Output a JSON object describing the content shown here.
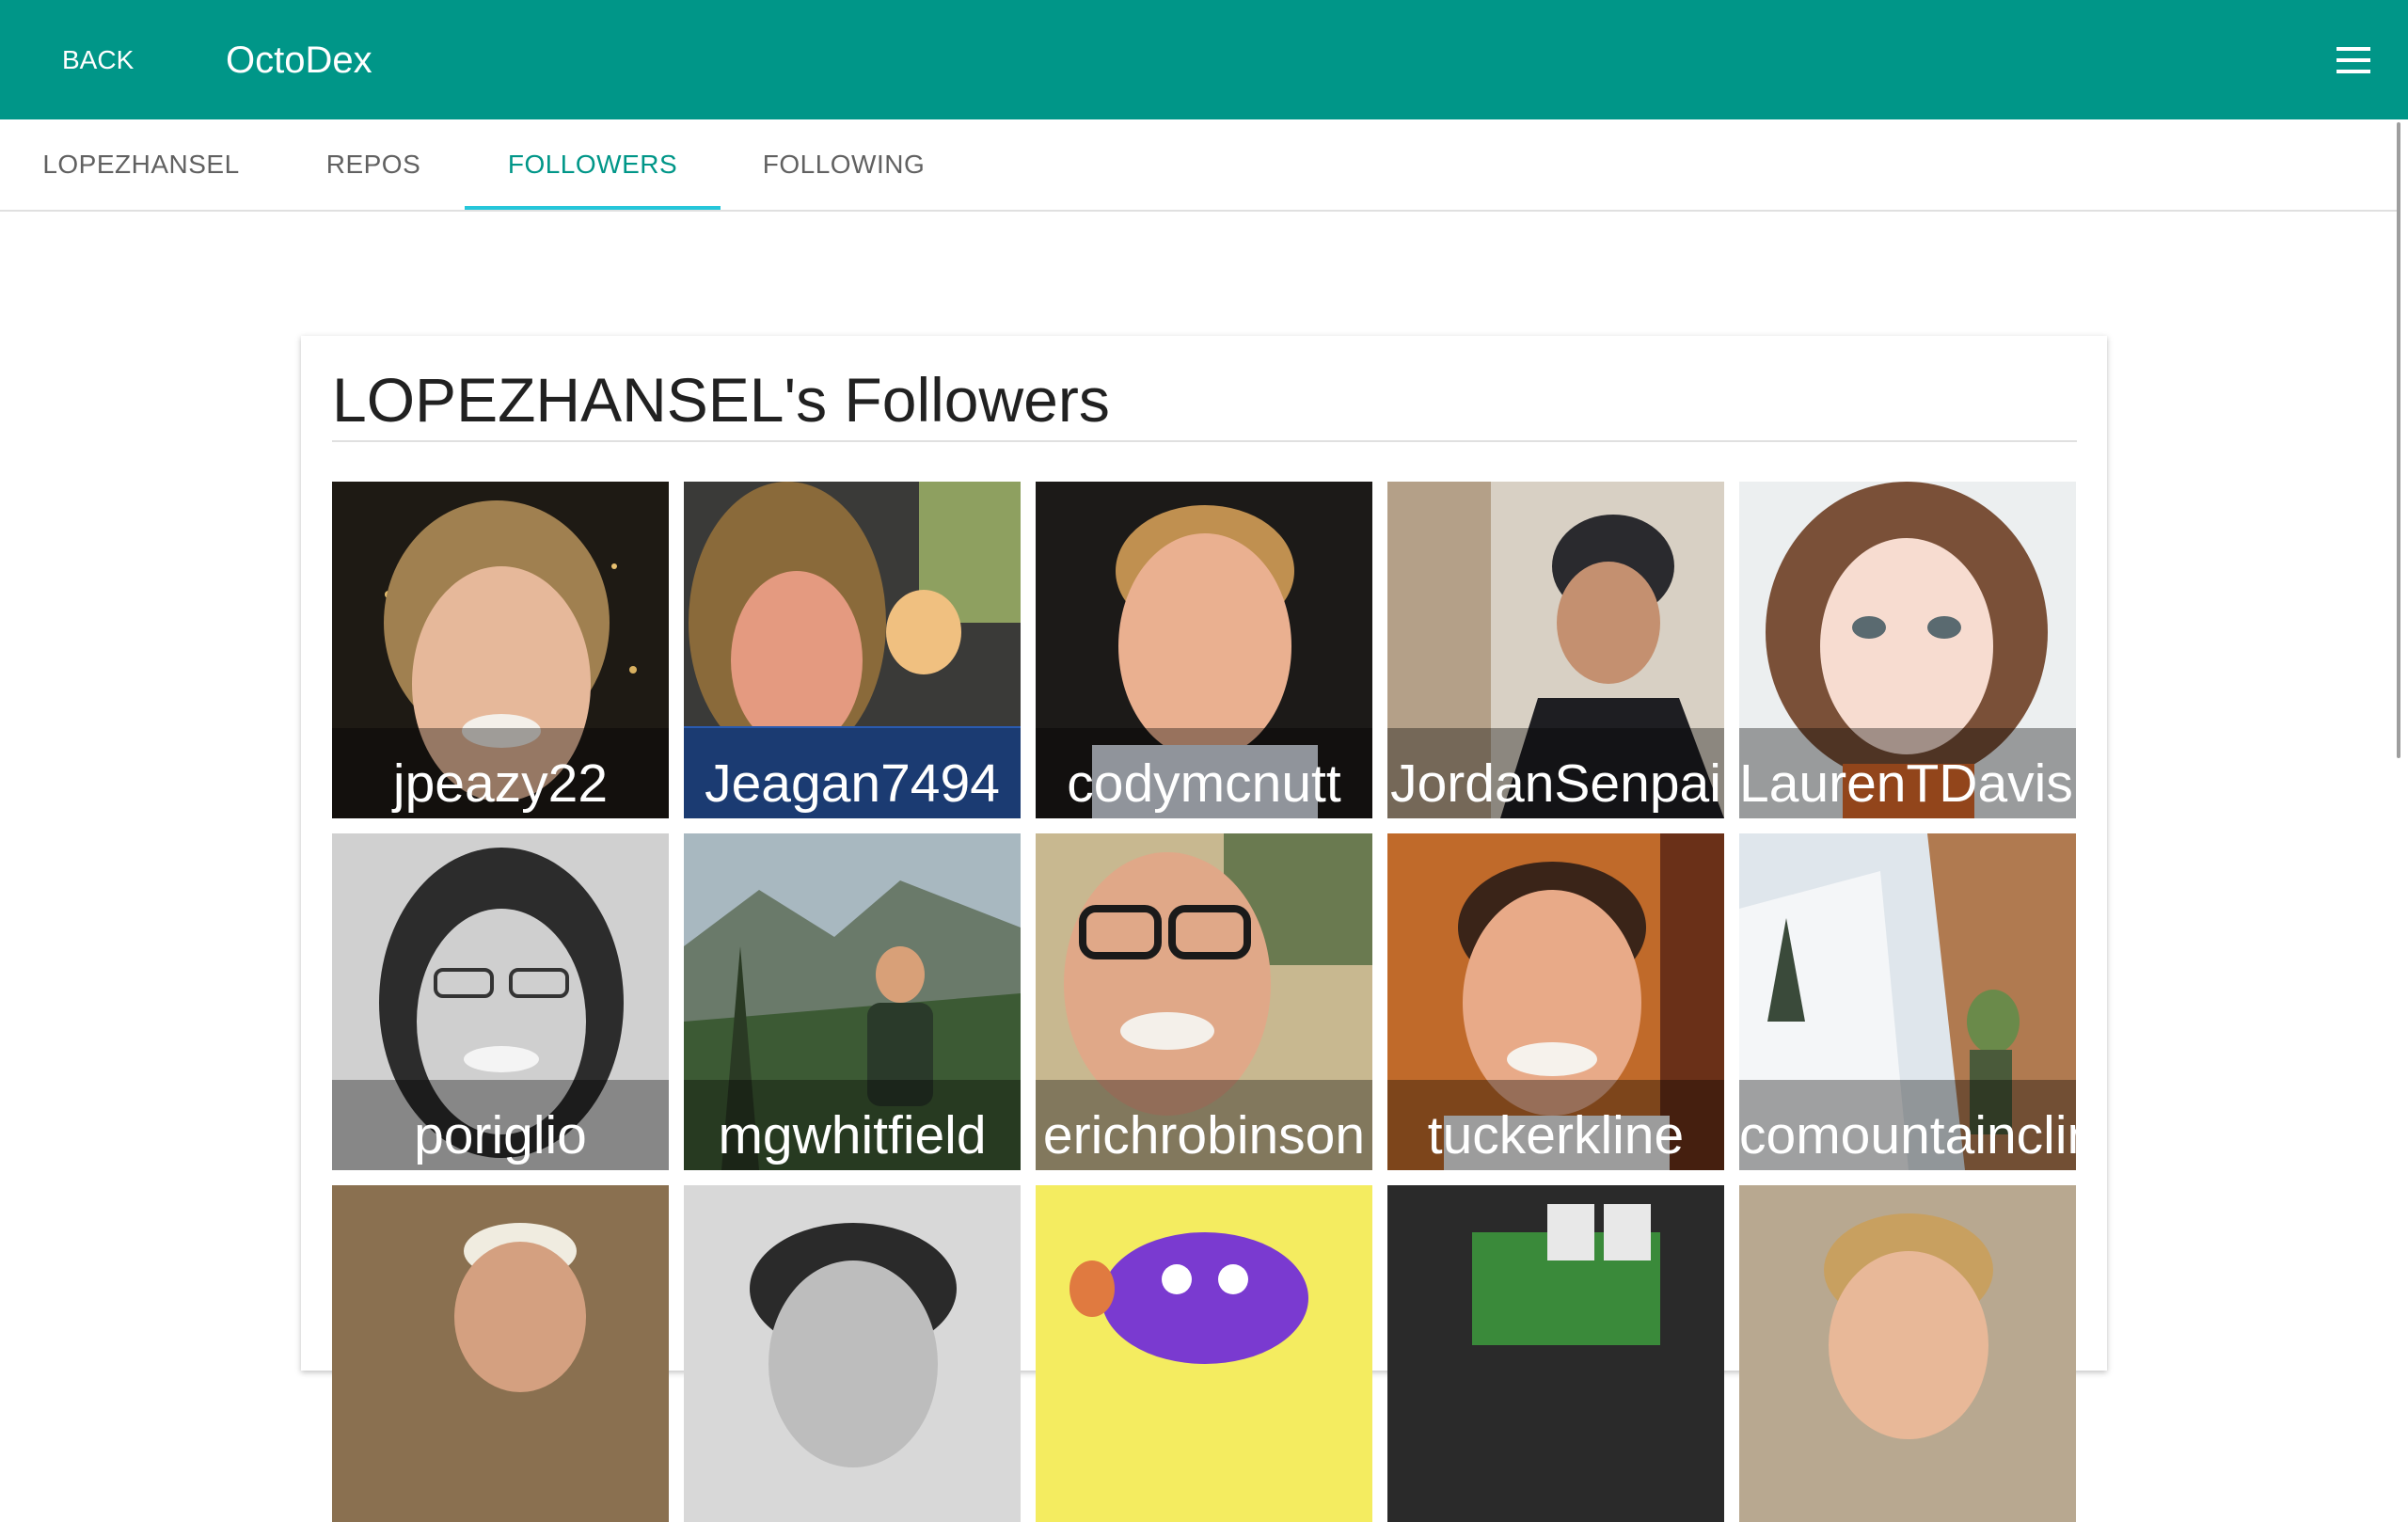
{
  "app": {
    "title": "OctoDex",
    "back_label": "BACK",
    "menu_icon": "hamburger-menu-icon"
  },
  "tabs": [
    {
      "label": "LOPEZHANSEL",
      "active": false
    },
    {
      "label": "REPOS",
      "active": false
    },
    {
      "label": "FOLLOWERS",
      "active": true
    },
    {
      "label": "FOLLOWING",
      "active": false
    }
  ],
  "colors": {
    "primary": "#009688",
    "indicator": "#26c6da",
    "tab_text": "#616161"
  },
  "card": {
    "title": "LOPEZHANSEL's Followers"
  },
  "followers": [
    {
      "login": "jpeazy22"
    },
    {
      "login": "Jeagan7494"
    },
    {
      "login": "codymcnutt"
    },
    {
      "login": "JordanSenpai"
    },
    {
      "login": "LaurenTDavis"
    },
    {
      "login": "poriglio"
    },
    {
      "login": "mgwhitfield"
    },
    {
      "login": "erichrobinson"
    },
    {
      "login": "tuckerkline"
    },
    {
      "login": "comountainclimber"
    },
    {
      "login": ""
    },
    {
      "login": ""
    },
    {
      "login": ""
    },
    {
      "login": ""
    },
    {
      "login": ""
    }
  ]
}
